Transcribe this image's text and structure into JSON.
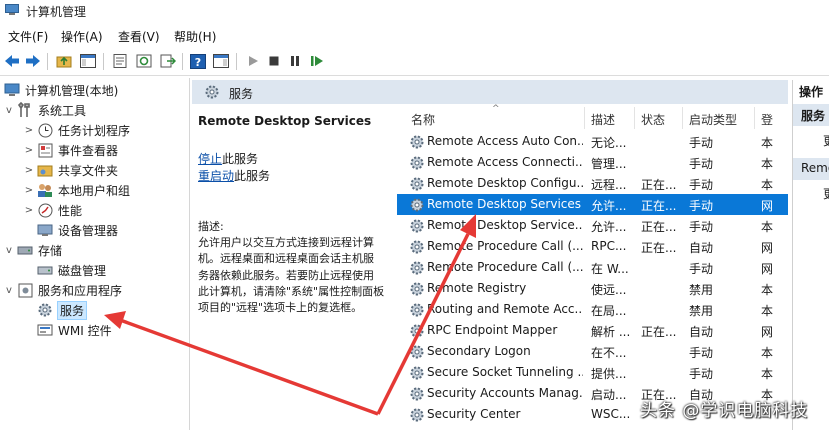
{
  "window": {
    "title": "计算机管理"
  },
  "menu": [
    "文件(F)",
    "操作(A)",
    "查看(V)",
    "帮助(H)"
  ],
  "tree": {
    "root": "计算机管理(本地)",
    "system_tools": "系统工具",
    "task_scheduler": "任务计划程序",
    "event_viewer": "事件查看器",
    "shared_folders": "共享文件夹",
    "local_users": "本地用户和组",
    "performance": "性能",
    "device_manager": "设备管理器",
    "storage": "存储",
    "disk_management": "磁盘管理",
    "services_apps": "服务和应用程序",
    "services": "服务",
    "wmi": "WMI 控件"
  },
  "center": {
    "header": "服务",
    "selected_service": "Remote Desktop Services",
    "stop_link": "停止",
    "stop_suffix": "此服务",
    "restart_link": "重启动",
    "restart_suffix": "此服务",
    "desc_label": "描述:",
    "desc_text": "允许用户以交互方式连接到远程计算\n机。远程桌面和远程桌面会话主机服\n务器依赖此服务。若要防止远程使用\n此计算机，请清除\"系统\"属性控制面板\n项目的\"远程\"选项卡上的复选框。"
  },
  "columns": [
    "名称",
    "描述",
    "状态",
    "启动类型",
    "登"
  ],
  "services": [
    {
      "name": "Remote Access Auto Con...",
      "desc": "无论...",
      "status": "",
      "startup": "手动",
      "logon": "本"
    },
    {
      "name": "Remote Access Connecti...",
      "desc": "管理...",
      "status": "",
      "startup": "手动",
      "logon": "本"
    },
    {
      "name": "Remote Desktop Configu...",
      "desc": "远程...",
      "status": "正在...",
      "startup": "手动",
      "logon": "本"
    },
    {
      "name": "Remote Desktop Services",
      "desc": "允许...",
      "status": "正在...",
      "startup": "手动",
      "logon": "网"
    },
    {
      "name": "Remote Desktop Service...",
      "desc": "允许...",
      "status": "正在...",
      "startup": "手动",
      "logon": "本"
    },
    {
      "name": "Remote Procedure Call (...",
      "desc": "RPC...",
      "status": "正在...",
      "startup": "自动",
      "logon": "网"
    },
    {
      "name": "Remote Procedure Call (...",
      "desc": "在 W...",
      "status": "",
      "startup": "手动",
      "logon": "网"
    },
    {
      "name": "Remote Registry",
      "desc": "使远...",
      "status": "",
      "startup": "禁用",
      "logon": "本"
    },
    {
      "name": "Routing and Remote Acc...",
      "desc": "在局...",
      "status": "",
      "startup": "禁用",
      "logon": "本"
    },
    {
      "name": "RPC Endpoint Mapper",
      "desc": "解析 ...",
      "status": "正在...",
      "startup": "自动",
      "logon": "网"
    },
    {
      "name": "Secondary Logon",
      "desc": "在不...",
      "status": "",
      "startup": "手动",
      "logon": "本"
    },
    {
      "name": "Secure Socket Tunneling ...",
      "desc": "提供...",
      "status": "",
      "startup": "手动",
      "logon": "本"
    },
    {
      "name": "Security Accounts Manag...",
      "desc": "启动...",
      "status": "正在...",
      "startup": "自动",
      "logon": "本"
    },
    {
      "name": "Security Center",
      "desc": "WSC...",
      "status": "",
      "startup": "",
      "logon": ""
    }
  ],
  "selected_index": 3,
  "actions": {
    "header": "操作",
    "services": "服务",
    "more1": "更",
    "remote": "Remo",
    "more2": "更"
  },
  "watermark": "头条 @学识电脑科技",
  "colors": {
    "accent": "#0a78d7",
    "header_bg": "#dde6f0",
    "arrow": "#e53935"
  }
}
